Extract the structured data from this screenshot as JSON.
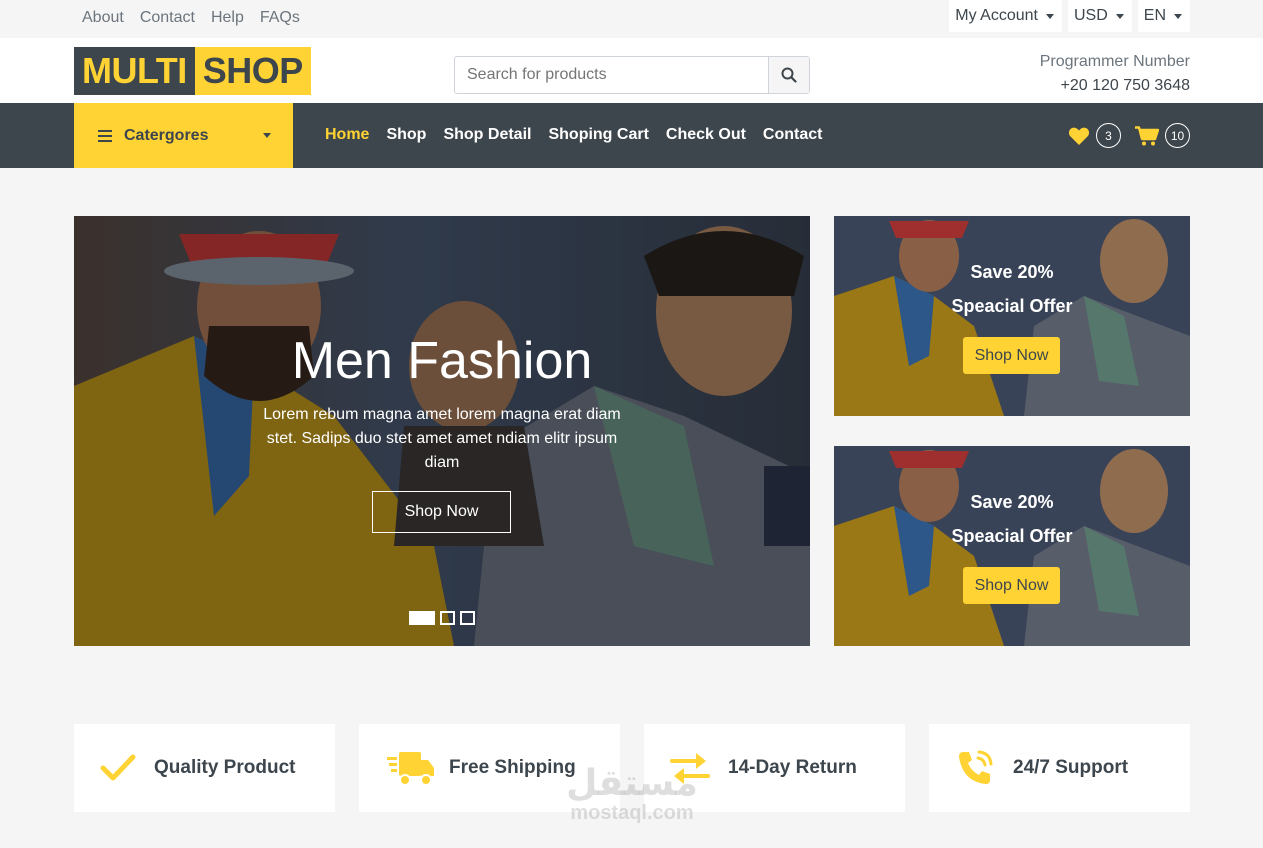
{
  "topbar": {
    "links": [
      "About",
      "Contact",
      "Help",
      "FAQs"
    ],
    "account_label": "My Account",
    "currency_label": "USD",
    "language_label": "EN"
  },
  "header": {
    "logo_part1": "MULTI",
    "logo_part2": "SHOP",
    "search_placeholder": "Search for products",
    "contact_label": "Programmer Number",
    "contact_number": "+20 120 750 3648"
  },
  "nav": {
    "categories_label": "Catergores",
    "links": [
      "Home",
      "Shop",
      "Shop Detail",
      "Shoping Cart",
      "Check Out",
      "Contact"
    ],
    "active_index": 0,
    "wishlist_count": "3",
    "cart_count": "10"
  },
  "carousel": {
    "title": "Men Fashion",
    "text": "Lorem rebum magna amet lorem magna erat diam stet. Sadips duo stet amet amet ndiam elitr ipsum diam",
    "button_label": "Shop Now",
    "slides": 3,
    "active_slide": 0
  },
  "offers": [
    {
      "line1": "Save 20%",
      "line2": "Speacial Offer",
      "button_label": "Shop Now"
    },
    {
      "line1": "Save 20%",
      "line2": "Speacial Offer",
      "button_label": "Shop Now"
    }
  ],
  "features": [
    {
      "icon": "check-icon",
      "label": "Quality Product"
    },
    {
      "icon": "truck-icon",
      "label": "Free Shipping"
    },
    {
      "icon": "exchange-icon",
      "label": "14-Day Return"
    },
    {
      "icon": "phone-volume-icon",
      "label": "24/7 Support"
    }
  ],
  "watermark": {
    "line1": "مستقل",
    "line2": "mostaql.com"
  },
  "colors": {
    "primary": "#ffd333",
    "dark": "#3d464d",
    "light": "#f5f5f5"
  }
}
